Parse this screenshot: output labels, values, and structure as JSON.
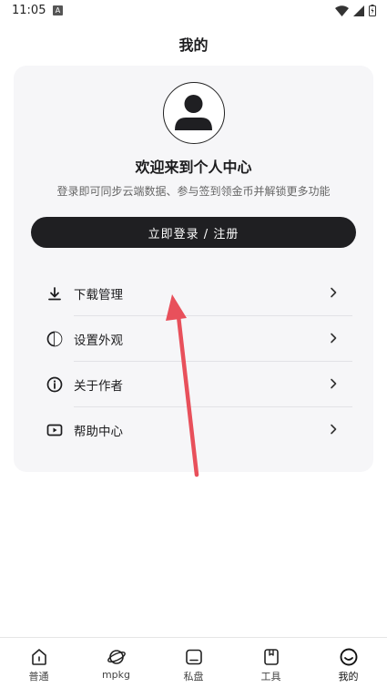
{
  "status": {
    "time": "11:05",
    "notif_letter": "A"
  },
  "header": {
    "title": "我的"
  },
  "profile": {
    "welcome": "欢迎来到个人中心",
    "subtitle": "登录即可同步云端数据、参与签到领金币并解锁更多功能",
    "login_label": "立即登录 / 注册"
  },
  "menu": [
    {
      "label": "下载管理",
      "icon": "download-icon"
    },
    {
      "label": "设置外观",
      "icon": "appearance-icon"
    },
    {
      "label": "关于作者",
      "icon": "info-icon"
    },
    {
      "label": "帮助中心",
      "icon": "help-icon"
    }
  ],
  "tabs": [
    {
      "label": "普通",
      "icon": "home-icon"
    },
    {
      "label": "mpkg",
      "icon": "planet-icon"
    },
    {
      "label": "私盘",
      "icon": "folder-icon"
    },
    {
      "label": "工具",
      "icon": "toolbox-icon"
    },
    {
      "label": "我的",
      "icon": "smile-icon"
    }
  ]
}
